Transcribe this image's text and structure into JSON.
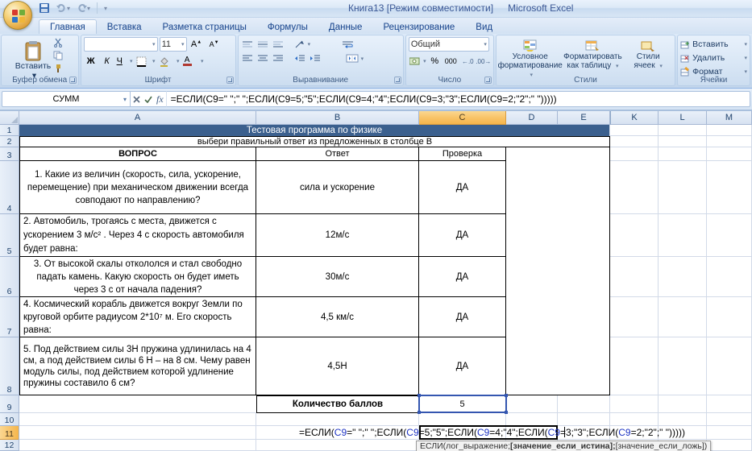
{
  "colors": {
    "k": "#000000",
    "ref": "#1F35C4",
    "banner_bg": "#3B608E",
    "selection_border": "#3456B0",
    "selected_header_bg": "#F6B854"
  },
  "title_bar": {
    "document": "Книга13  [Режим совместимости]",
    "app": "Microsoft Excel"
  },
  "ribbon": {
    "tabs": [
      {
        "label": "Главная"
      },
      {
        "label": "Вставка"
      },
      {
        "label": "Разметка страницы"
      },
      {
        "label": "Формулы"
      },
      {
        "label": "Данные"
      },
      {
        "label": "Рецензирование"
      },
      {
        "label": "Вид"
      }
    ],
    "clipboard": {
      "label": "Буфер обмена",
      "paste": "Вставить"
    },
    "font": {
      "label": "Шрифт",
      "size": "11",
      "bold": "Ж",
      "italic": "К",
      "underline": "Ч"
    },
    "alignment": {
      "label": "Выравнивание"
    },
    "number": {
      "label": "Число",
      "format": "Общий",
      "percent": "%",
      "thousands": "000"
    },
    "styles": {
      "label": "Стили",
      "conditional": "Условное форматирование",
      "as_table": "Форматировать как таблицу",
      "cell_styles": "Стили ячеек"
    },
    "cells": {
      "label": "Ячейки",
      "insert": "Вставить",
      "delete": "Удалить",
      "format": "Формат"
    }
  },
  "formula_bar": {
    "name_box": "СУММ",
    "fx": "fx",
    "formula": "=ЕСЛИ(C9=\" \";\" \";ЕСЛИ(C9=5;\"5\";ЕСЛИ(C9=4;\"4\";ЕСЛИ(C9=3;\"3\";ЕСЛИ(C9=2;\"2\";\" \")))))"
  },
  "grid": {
    "columns": [
      "A",
      "B",
      "C",
      "D",
      "E",
      "K",
      "L",
      "M"
    ],
    "rows": [
      "1",
      "2",
      "3",
      "4",
      "5",
      "6",
      "7",
      "8",
      "9",
      "10",
      "11",
      "12"
    ],
    "selected_column": "C",
    "selected_row": "11",
    "title": "Тестовая программа по физике",
    "subtitle": "выбери правильный ответ из предложенных в столбце В",
    "col_question": "ВОПРОС",
    "col_answer": "Ответ",
    "col_check": "Проверка",
    "qa": [
      {
        "q": "1. Какие из величин (скорость, сила, ускорение, перемещение) при механическом движении всегда совподают по направлению?",
        "a": "сила и ускорение",
        "check": "ДА"
      },
      {
        "q": "2. Автомобиль, трогаясь с места, движется с ускорением 3 м/с² . Через 4 с скорость автомобиля будет равна:",
        "a": "12м/с",
        "check": "ДА"
      },
      {
        "q": "3. От высокой скалы откололся и стал свободно падать камень. Какую скорость он будет иметь через 3 с от начала падения?",
        "a": "30м/с",
        "check": "ДА"
      },
      {
        "q": "4. Космический корабль движется вокруг Земли по круговой орбите радиусом 2*10⁷ м. Его скорость равна:",
        "a": "4,5 км/с",
        "check": "ДА"
      },
      {
        "q": "5. Под действием силы 3Н пружина удлинилась на 4 см, а под действием силы 6 Н – на 8 см. Чему равен модуль силы, под действием  которой удлинение пружины составило 6 см?",
        "a": "4,5Н",
        "check": "ДА"
      }
    ],
    "score_label": "Количество баллов",
    "score": "5",
    "edit_formula_parts": [
      {
        "t": "=ЕСЛИ(",
        "c": "k"
      },
      {
        "t": "C9",
        "c": "ref"
      },
      {
        "t": "=\" \";\" \";ЕСЛИ(",
        "c": "k"
      },
      {
        "t": "C9",
        "c": "ref"
      },
      {
        "t": "=5;\"5\";ЕСЛИ(",
        "c": "k"
      },
      {
        "t": "C9",
        "c": "ref"
      },
      {
        "t": "=4;\"4\";ЕСЛИ(",
        "c": "k"
      },
      {
        "t": "C9",
        "c": "ref"
      },
      {
        "t": "=3;\"3\";ЕСЛИ(",
        "c": "k"
      },
      {
        "t": "C9",
        "c": "ref"
      },
      {
        "t": "=2;\"2\";\" \")))))",
        "c": "k"
      }
    ],
    "tooltip_parts": [
      {
        "t": "ЕСЛИ(лог_выражение; ",
        "b": 0
      },
      {
        "t": "[значение_если_истина];",
        "b": 1
      },
      {
        "t": " [значение_если_ложь])",
        "b": 0
      }
    ]
  }
}
